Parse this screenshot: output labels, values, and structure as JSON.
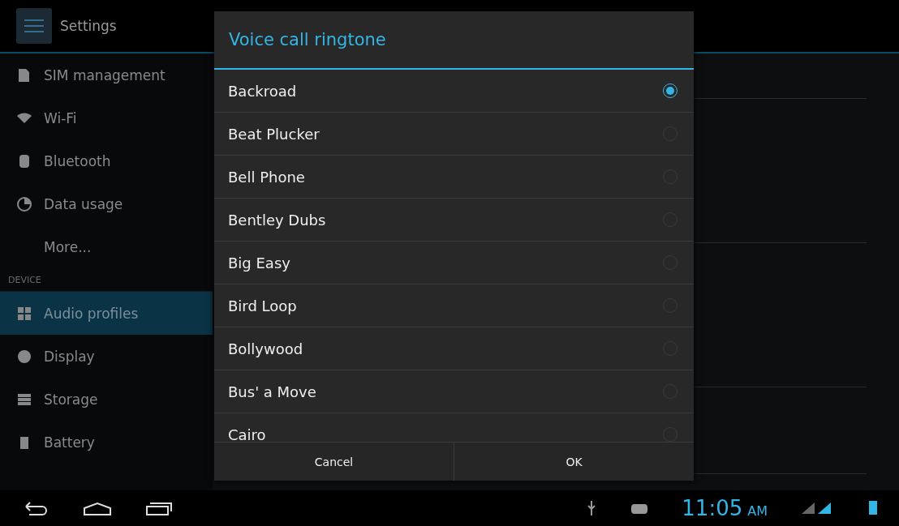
{
  "header": {
    "title": "Settings"
  },
  "sidebar": {
    "items": [
      {
        "kind": "item",
        "label": "SIM management",
        "selected": false
      },
      {
        "kind": "item",
        "label": "Wi-Fi",
        "selected": false
      },
      {
        "kind": "item",
        "label": "Bluetooth",
        "selected": false
      },
      {
        "kind": "item",
        "label": "Data usage",
        "selected": false
      },
      {
        "kind": "item",
        "label": "More...",
        "selected": false
      },
      {
        "kind": "header",
        "label": "DEVICE"
      },
      {
        "kind": "item",
        "label": "Audio profiles",
        "selected": true
      },
      {
        "kind": "item",
        "label": "Display",
        "selected": false
      },
      {
        "kind": "item",
        "label": "Storage",
        "selected": false
      },
      {
        "kind": "item",
        "label": "Battery",
        "selected": false
      }
    ]
  },
  "dialog": {
    "title": "Voice call ringtone",
    "options": [
      {
        "label": "Backroad",
        "selected": true
      },
      {
        "label": "Beat Plucker",
        "selected": false
      },
      {
        "label": "Bell Phone",
        "selected": false
      },
      {
        "label": "Bentley Dubs",
        "selected": false
      },
      {
        "label": "Big Easy",
        "selected": false
      },
      {
        "label": "Bird Loop",
        "selected": false
      },
      {
        "label": "Bollywood",
        "selected": false
      },
      {
        "label": "Bus' a Move",
        "selected": false
      },
      {
        "label": "Cairo",
        "selected": false
      }
    ],
    "buttons": [
      "Cancel",
      "OK"
    ]
  },
  "status_bar": {
    "time": "11:05",
    "ampm": "AM"
  }
}
